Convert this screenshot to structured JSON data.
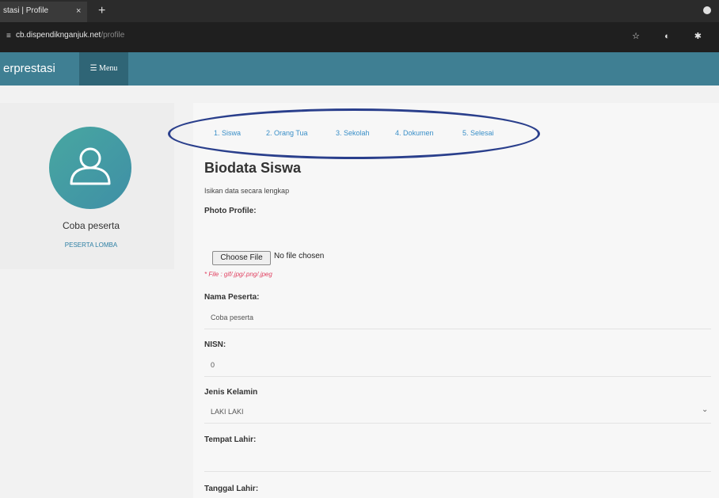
{
  "browser": {
    "tab_title": "stasi | Profile",
    "tab_close": "×",
    "tab_new": "+",
    "url_host": "cb.dispendiknganjuk.net",
    "url_path": "/profile",
    "url_icons": "☆ ◐ ✱"
  },
  "appnav": {
    "brand": "erprestasi",
    "menu_label": "☰ Menu"
  },
  "sidebar": {
    "user_name": "Coba peserta",
    "user_role": "PESERTA LOMBA"
  },
  "steps": [
    "1. Siswa",
    "2. Orang Tua",
    "3. Sekolah",
    "4. Dokumen",
    "5. Selesai"
  ],
  "form": {
    "title": "Biodata Siswa",
    "subtitle": "Isikan data secara lengkap",
    "photo_label": "Photo Profile:",
    "choose_file": "Choose File",
    "no_file": "No file chosen",
    "file_hint": "* File : gif/.jpg/.png/.jpeg",
    "nama_label": "Nama Peserta:",
    "nama_value": "Coba peserta",
    "nisn_label": "NISN:",
    "nisn_value": "0",
    "jk_label": "Jenis Kelamin",
    "jk_value": "LAKI LAKI",
    "tempat_label": "Tempat Lahir:",
    "tempat_value": "",
    "tanggal_label": "Tanggal Lahir:"
  },
  "colors": {
    "nav": "#3f7f93",
    "accent": "#3a8fc8",
    "ellipse": "#2a3f8c",
    "hint": "#e04060"
  }
}
